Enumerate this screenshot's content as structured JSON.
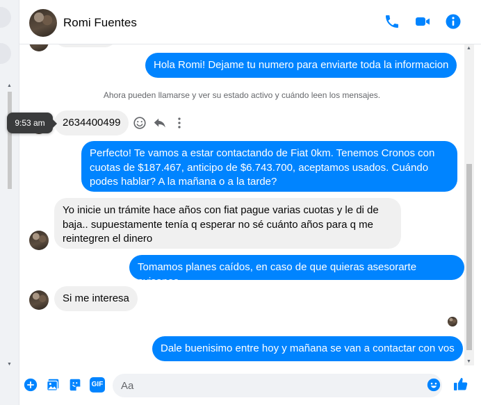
{
  "header": {
    "contact_name": "Romi Fuentes",
    "icons": [
      "phone-icon",
      "video-call-icon",
      "info-icon"
    ]
  },
  "system_note": "Ahora pueden llamarse y ver su estado activo y cuándo leen los mensajes.",
  "tooltip": "9:53 am",
  "messages": [
    {
      "from": "me",
      "text": "Hola Romi! Dejame tu numero para enviarte toda la informacion"
    },
    {
      "from": "them",
      "text": "2634400499"
    },
    {
      "from": "me",
      "text": "Perfecto! Te vamos a estar contactando de Fiat 0km. Tenemos Cronos con cuotas de $187.467, anticipo de $6.743.700, aceptamos usados. Cuándo podes hablar? A la mañana o a la tarde?"
    },
    {
      "from": "them",
      "text": "Yo inicie un trámite hace años con fiat pague varias cuotas y le di de baja.. supuestamente tenía q esperar no sé cuánto años para q me reintegren el dinero"
    },
    {
      "from": "me",
      "text": "Tomamos planes caídos, en caso de que quieras asesorarte avisanos"
    },
    {
      "from": "them",
      "text": "Si me interesa"
    },
    {
      "from": "me",
      "text": "Dale buenisimo entre hoy y mañana se van a contactar con vos"
    }
  ],
  "composer": {
    "placeholder": "Aa",
    "icons": [
      "plus-circle-icon",
      "gallery-icon",
      "sticker-icon",
      "gif-icon",
      "emoji-icon",
      "like-icon"
    ],
    "gif_label": "GIF"
  },
  "colors": {
    "accent": "#0084ff",
    "incoming_bubble": "#f0f0f0",
    "text": "#050505",
    "muted": "#65676b"
  }
}
